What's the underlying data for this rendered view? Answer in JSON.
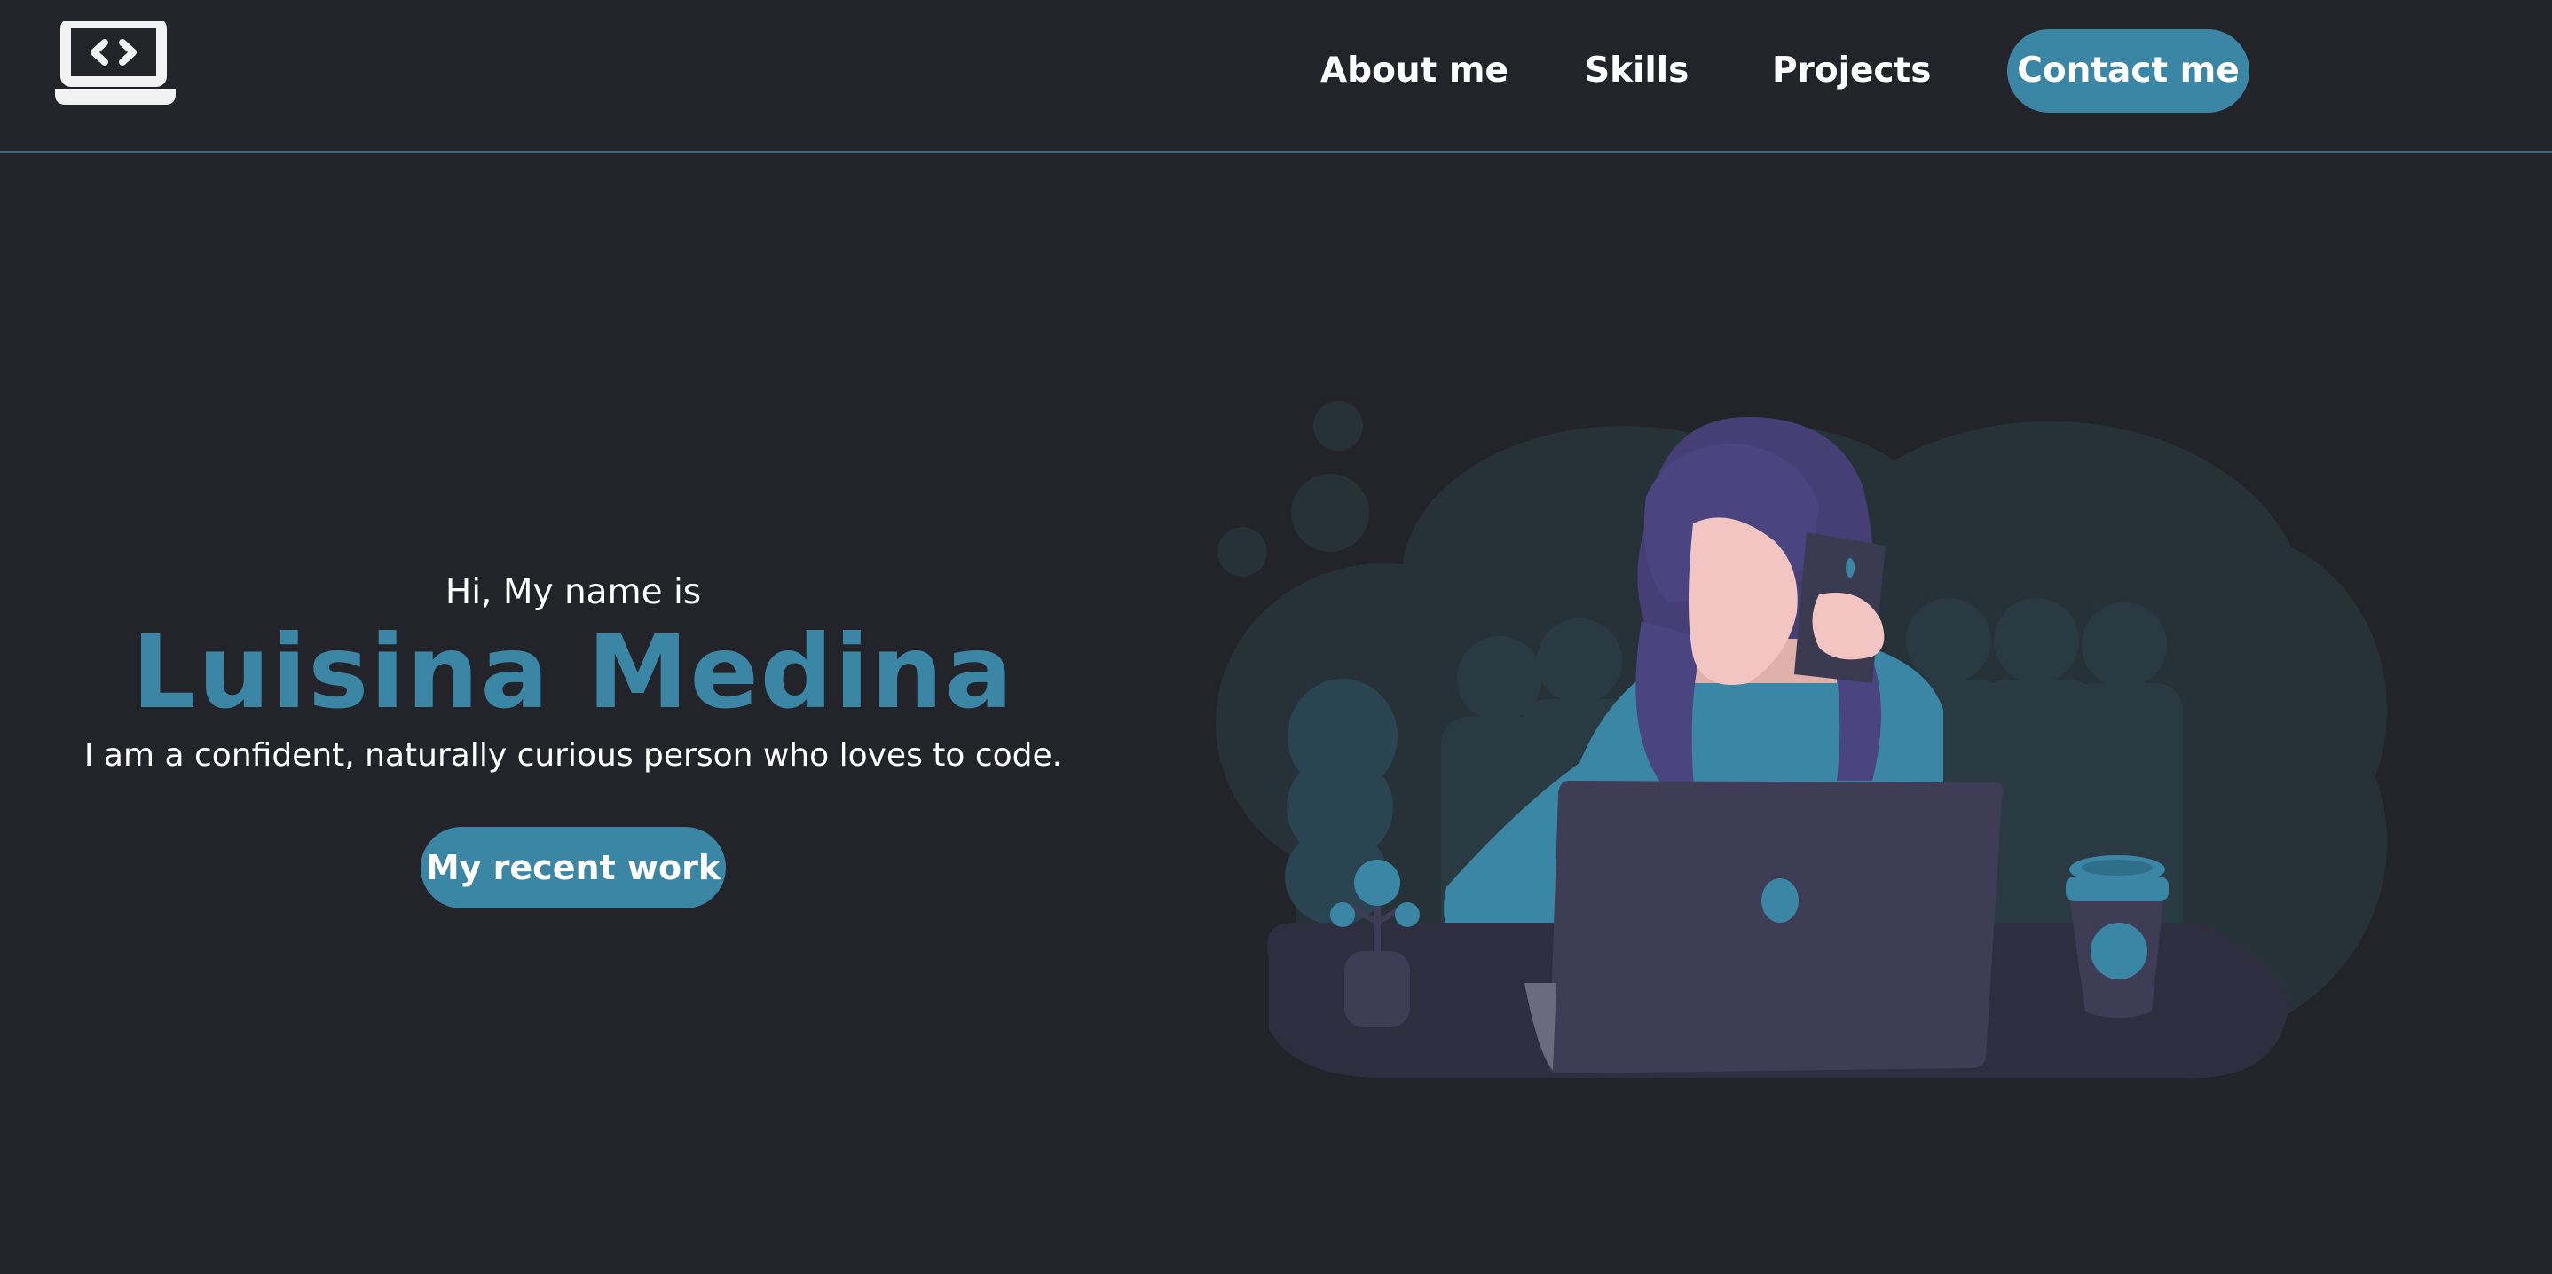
{
  "header": {
    "logo_icon": "laptop-code-icon",
    "nav": {
      "about": "About me",
      "skills": "Skills",
      "projects": "Projects",
      "contact": "Contact me"
    }
  },
  "hero": {
    "greeting": "Hi, My name is",
    "name": "Luisina Medina",
    "tagline": "I am a confident, naturally curious person who loves to code.",
    "cta": "My recent work"
  },
  "illustration": {
    "icon": "woman-on-phone-at-laptop-illustration"
  },
  "colors": {
    "background": "#232429",
    "accent": "#3b86a5",
    "text": "#ffffff",
    "divider": "#3d6d86"
  }
}
